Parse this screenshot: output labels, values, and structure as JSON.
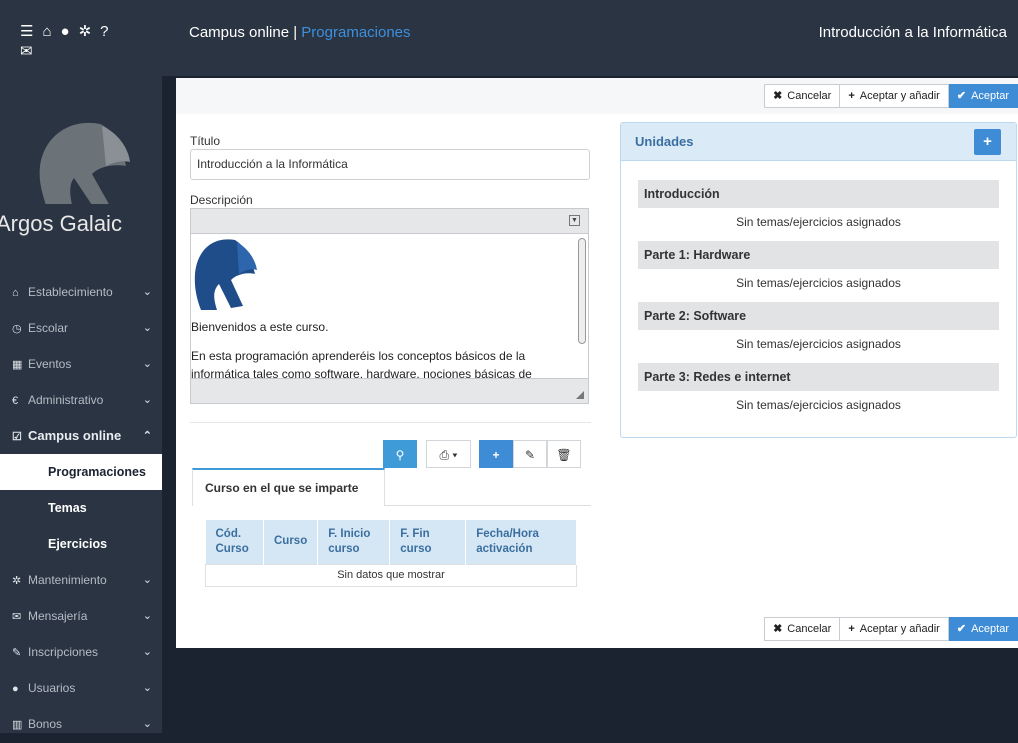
{
  "topbar": {
    "icons": [
      "list-icon",
      "home-icon",
      "user-icon",
      "gear-icon",
      "help-icon",
      "chat-icon"
    ],
    "app_title": "Campus online | ",
    "app_section": "Programaciones",
    "course_title": "Introducción a la Informática"
  },
  "sidebar": {
    "brand": "Argos Galaic",
    "items": [
      {
        "label": "Establecimiento",
        "icon": "home-icon"
      },
      {
        "label": "Escolar",
        "icon": "clock-icon"
      },
      {
        "label": "Eventos",
        "icon": "calendar-icon"
      },
      {
        "label": "Administrativo",
        "icon": "euro-icon"
      },
      {
        "label": "Campus online",
        "icon": "edit-check-icon"
      }
    ],
    "subitems": [
      "Programaciones",
      "Temas",
      "Ejercicios"
    ],
    "items_after": [
      {
        "label": "Mantenimiento",
        "icon": "gear-icon"
      },
      {
        "label": "Mensajería",
        "icon": "envelope-icon"
      },
      {
        "label": "Inscripciones",
        "icon": "pencil-icon"
      },
      {
        "label": "Usuarios",
        "icon": "user-icon"
      },
      {
        "label": "Bonos",
        "icon": "barcode-icon"
      }
    ]
  },
  "actions": {
    "cancel": "Cancelar",
    "accept_add": "Aceptar y añadir",
    "accept": "Aceptar"
  },
  "form": {
    "title_label": "Título",
    "title_value": "Introducción a la Informática",
    "desc_label": "Descripción",
    "desc_p1": "Bienvenidos a este curso.",
    "desc_p2": "En esta programación aprenderéis los conceptos básicos de la informática tales como software, hardware, nociones básicas de"
  },
  "toolbar": {
    "search": "search-icon",
    "print": "print-icon",
    "add": "plus-icon",
    "edit": "pencil-icon",
    "delete": "trash-icon"
  },
  "tab": {
    "label": "Curso en el que se imparte"
  },
  "table": {
    "headers": [
      "Cód. Curso",
      "Curso",
      "F. Inicio curso",
      "F. Fin curso",
      "Fecha/Hora activación"
    ],
    "empty": "Sin datos que mostrar"
  },
  "units": {
    "title": "Unidades",
    "items": [
      {
        "name": "Introducción",
        "empty": "Sin temas/ejercicios asignados"
      },
      {
        "name": "Parte 1: Hardware",
        "empty": "Sin temas/ejercicios asignados"
      },
      {
        "name": "Parte 2: Software",
        "empty": "Sin temas/ejercicios asignados"
      },
      {
        "name": "Parte 3: Redes e internet",
        "empty": "Sin temas/ejercicios asignados"
      }
    ]
  },
  "colors": {
    "dark": "#2a3442",
    "accent": "#3f8cd6",
    "panel_head": "#dbeaf7"
  }
}
